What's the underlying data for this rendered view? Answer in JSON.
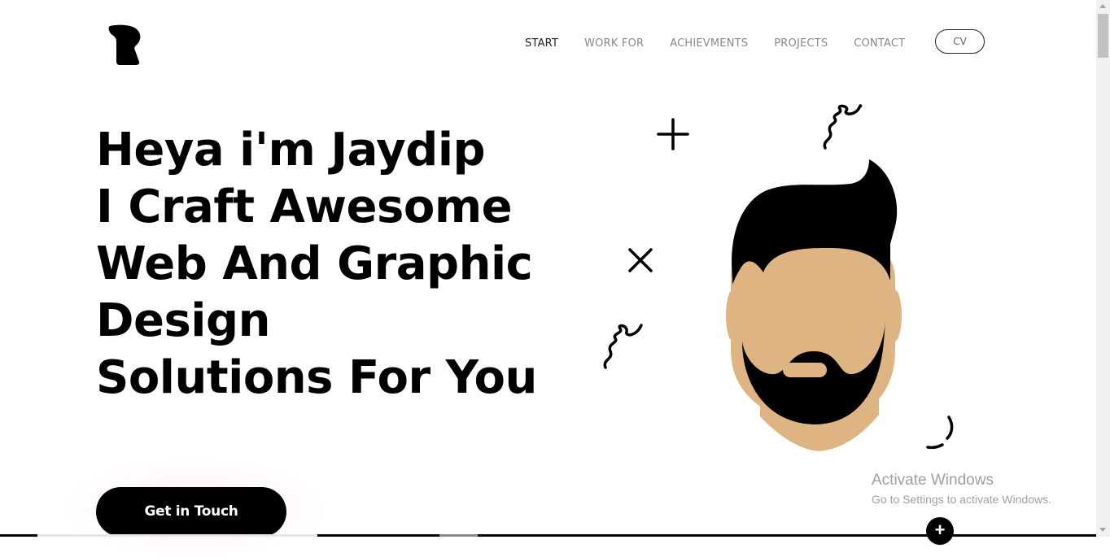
{
  "nav": {
    "items": [
      {
        "label": "START",
        "active": true
      },
      {
        "label": "WORK FOR",
        "active": false
      },
      {
        "label": "ACHIEVMENTS",
        "active": false
      },
      {
        "label": "PROJECTS",
        "active": false
      },
      {
        "label": "CONTACT",
        "active": false
      }
    ],
    "cv_label": "CV"
  },
  "hero": {
    "lines": [
      "Heya i'm Jaydip",
      "I Craft Awesome",
      "Web And Graphic",
      "Design",
      "Solutions For You"
    ],
    "cta_label": "Get in Touch"
  },
  "watermark": {
    "title": "Activate Windows",
    "subtitle": "Go to Settings to activate Windows."
  },
  "scroll_button_glyph": "+",
  "colors": {
    "text": "#000000",
    "nav_inactive": "#888888",
    "skin": "#dfb483",
    "hair": "#000000"
  }
}
